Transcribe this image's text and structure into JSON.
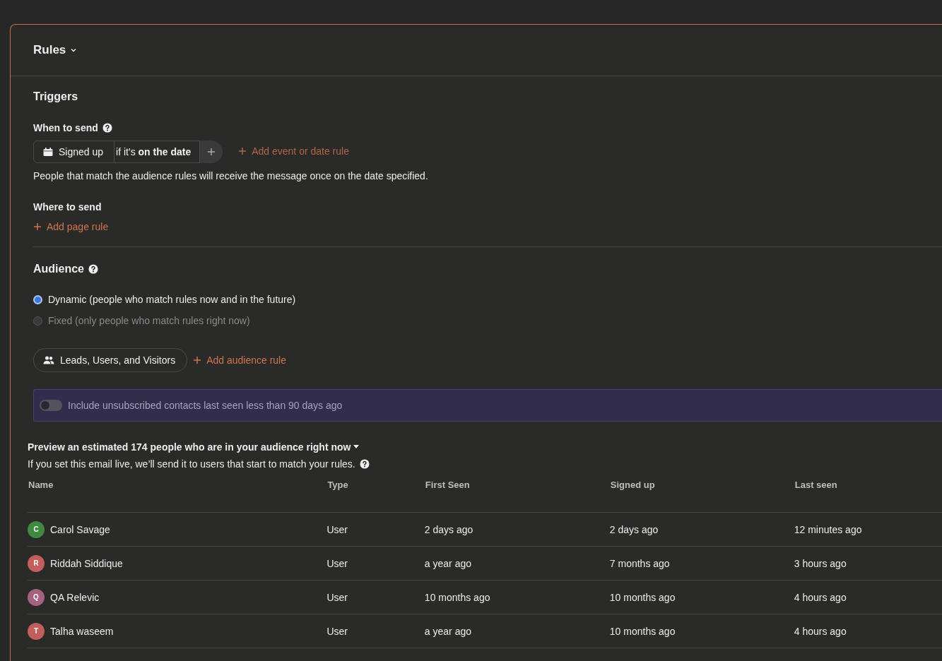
{
  "header": {
    "title": "Rules"
  },
  "triggers": {
    "title": "Triggers",
    "when_label": "When to send",
    "chip": {
      "event": "Signed up",
      "condition": "if it's **on the date**"
    },
    "add_event": "Add event or date rule",
    "description": "People that match the audience rules will receive the message once on the date specified.",
    "where_label": "Where to send",
    "add_page": "Add page rule"
  },
  "audience": {
    "title": "Audience",
    "options": [
      {
        "label": "Dynamic (people who match rules now and in the future)",
        "selected": true
      },
      {
        "label": "Fixed (only people who match rules right now)",
        "selected": false
      }
    ],
    "segment": "Leads, Users, and Visitors",
    "add_rule": "Add audience rule",
    "toggle": {
      "label": "Include unsubscribed contacts last seen less than 90 days ago",
      "on": false
    }
  },
  "preview": {
    "title": "Preview an estimated 174 people who are in your audience right now",
    "subtitle": "If you set this email live, we’ll send it to users that start to match your rules.",
    "columns": [
      "Name",
      "Type",
      "First Seen",
      "Signed up",
      "Last seen"
    ],
    "rows": [
      {
        "initial": "C",
        "color": "#3f8a3f",
        "name": "Carol Savage",
        "type": "User",
        "first_seen": "2 days ago",
        "signed_up": "2 days ago",
        "last_seen": "12 minutes ago"
      },
      {
        "initial": "R",
        "color": "#c25e5c",
        "name": "Riddah Siddique",
        "type": "User",
        "first_seen": "a year ago",
        "signed_up": "7 months ago",
        "last_seen": "3 hours ago"
      },
      {
        "initial": "Q",
        "color": "#a5617f",
        "name": "QA Relevic",
        "type": "User",
        "first_seen": "10 months ago",
        "signed_up": "10 months ago",
        "last_seen": "4 hours ago"
      },
      {
        "initial": "T",
        "color": "#c25e5c",
        "name": "Talha waseem",
        "type": "User",
        "first_seen": "a year ago",
        "signed_up": "10 months ago",
        "last_seen": "4 hours ago"
      }
    ]
  }
}
